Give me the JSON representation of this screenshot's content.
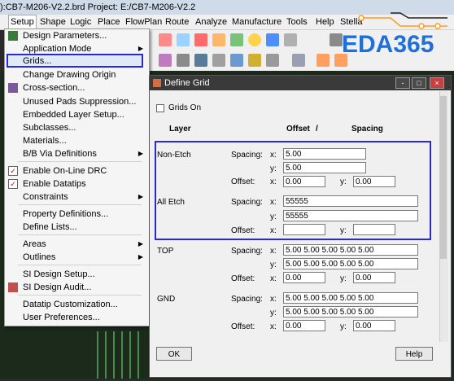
{
  "window": {
    "title": "):CB7-M206-V2.2.brd  Project: E:/CB7-M206-V2.2"
  },
  "menubar": [
    {
      "label": "Setup",
      "active": true
    },
    {
      "label": "Shape"
    },
    {
      "label": "Logic"
    },
    {
      "label": "Place"
    },
    {
      "label": "FlowPlan"
    },
    {
      "label": "Route"
    },
    {
      "label": "Analyze"
    },
    {
      "label": "Manufacture"
    },
    {
      "label": "Tools"
    },
    {
      "label": "Help"
    },
    {
      "label": "Stella"
    }
  ],
  "logo": {
    "text": "EDA365",
    "color": "#1e6fd9"
  },
  "setup_menu": [
    {
      "label": "Design Parameters...",
      "icon": "design-parameters-icon"
    },
    {
      "label": "Application Mode",
      "submenu": true
    },
    {
      "label": "Grids...",
      "highlighted": true
    },
    {
      "label": "Change Drawing Origin"
    },
    {
      "label": "Cross-section...",
      "icon": "cross-section-icon"
    },
    {
      "label": "Unused Pads Suppression..."
    },
    {
      "label": "Embedded Layer Setup..."
    },
    {
      "label": "Subclasses..."
    },
    {
      "label": "Materials..."
    },
    {
      "label": "B/B Via Definitions",
      "submenu": true
    },
    {
      "label": "Enable On-Line DRC",
      "checked": true
    },
    {
      "label": "Enable Datatips",
      "checked": true
    },
    {
      "label": "Constraints",
      "submenu": true
    },
    {
      "label": "Property Definitions..."
    },
    {
      "label": "Define Lists..."
    },
    {
      "label": "Areas",
      "submenu": true
    },
    {
      "label": "Outlines",
      "submenu": true
    },
    {
      "label": "SI Design Setup..."
    },
    {
      "label": "SI Design Audit...",
      "icon": "si-audit-icon"
    },
    {
      "label": "Datatip Customization..."
    },
    {
      "label": "User Preferences..."
    }
  ],
  "dialog": {
    "title": "Define Grid",
    "grids_on": "Grids On",
    "headers": {
      "layer": "Layer",
      "offset": "Offset",
      "slash": "/",
      "spacing": "Spacing"
    },
    "non_etch": {
      "name": "Non-Etch",
      "spacing_label": "Spacing:",
      "x_label": "x:",
      "x": "5.00",
      "y_label": "y:",
      "y": "5.00",
      "offset_label": "Offset:",
      "offset_x": "0.00",
      "offset_y": "0.00"
    },
    "all_etch": {
      "name": "All Etch",
      "spacing_label": "Spacing:",
      "x_label": "x:",
      "x": "55555",
      "y_label": "y:",
      "y": "55555",
      "offset_label": "Offset:",
      "offset_x": "",
      "offset_y": ""
    },
    "top": {
      "name": "TOP",
      "spacing_label": "Spacing:",
      "x_label": "x:",
      "x": "5.00 5.00 5.00 5.00 5.00",
      "y_label": "y:",
      "y": "5.00 5.00 5.00 5.00 5.00",
      "offset_label": "Offset:",
      "offset_x": "0.00",
      "offset_y": "0.00"
    },
    "gnd": {
      "name": "GND",
      "spacing_label": "Spacing:",
      "x_label": "x:",
      "x": "5.00 5.00 5.00 5.00 5.00",
      "y_label": "y:",
      "y": "5.00 5.00 5.00 5.00 5.00",
      "offset_label": "Offset:",
      "offset_x": "0.00",
      "offset_y": "0.00"
    },
    "ok": "OK",
    "help": "Help",
    "win_controls": {
      "minimize": "-",
      "maximize": "□",
      "close": "×"
    }
  }
}
